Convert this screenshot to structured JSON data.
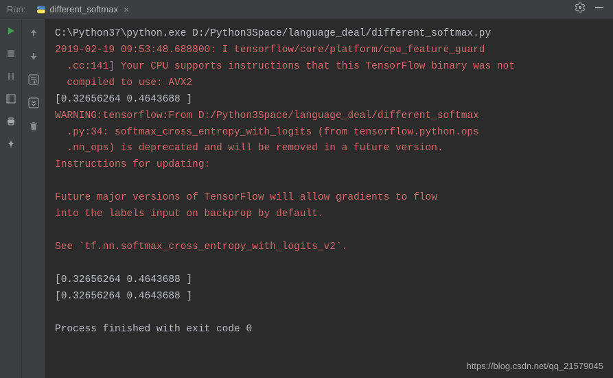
{
  "header": {
    "run_label": "Run:",
    "tab_title": "different_softmax"
  },
  "console": {
    "lines": [
      {
        "cls": "out-line",
        "t": "C:\\Python37\\python.exe D:/Python3Space/language_deal/different_softmax.py"
      },
      {
        "cls": "warn-line",
        "t": "2019-02-19 09:53:48.688800: I tensorflow/core/platform/cpu_feature_guard"
      },
      {
        "cls": "warn-line",
        "t": "  .cc:141] Your CPU supports instructions that this TensorFlow binary was not"
      },
      {
        "cls": "warn-line",
        "t": "  compiled to use: AVX2"
      },
      {
        "cls": "out-line",
        "t": "[0.32656264 0.4643688 ]"
      },
      {
        "cls": "warn-line",
        "t": "WARNING:tensorflow:From D:/Python3Space/language_deal/different_softmax"
      },
      {
        "cls": "warn-line",
        "t": "  .py:34: softmax_cross_entropy_with_logits (from tensorflow.python.ops"
      },
      {
        "cls": "warn-line",
        "t": "  .nn_ops) is deprecated and will be removed in a future version."
      },
      {
        "cls": "warn-line",
        "t": "Instructions for updating:"
      },
      {
        "cls": "warn-line",
        "t": ""
      },
      {
        "cls": "warn-line",
        "t": "Future major versions of TensorFlow will allow gradients to flow"
      },
      {
        "cls": "warn-line",
        "t": "into the labels input on backprop by default."
      },
      {
        "cls": "warn-line",
        "t": ""
      },
      {
        "cls": "warn-line",
        "t": "See `tf.nn.softmax_cross_entropy_with_logits_v2`."
      },
      {
        "cls": "out-line",
        "t": ""
      },
      {
        "cls": "out-line",
        "t": "[0.32656264 0.4643688 ]"
      },
      {
        "cls": "out-line",
        "t": "[0.32656264 0.4643688 ]"
      },
      {
        "cls": "out-line",
        "t": ""
      },
      {
        "cls": "out-line",
        "t": "Process finished with exit code 0"
      }
    ]
  },
  "watermark": "https://blog.csdn.net/qq_21579045"
}
